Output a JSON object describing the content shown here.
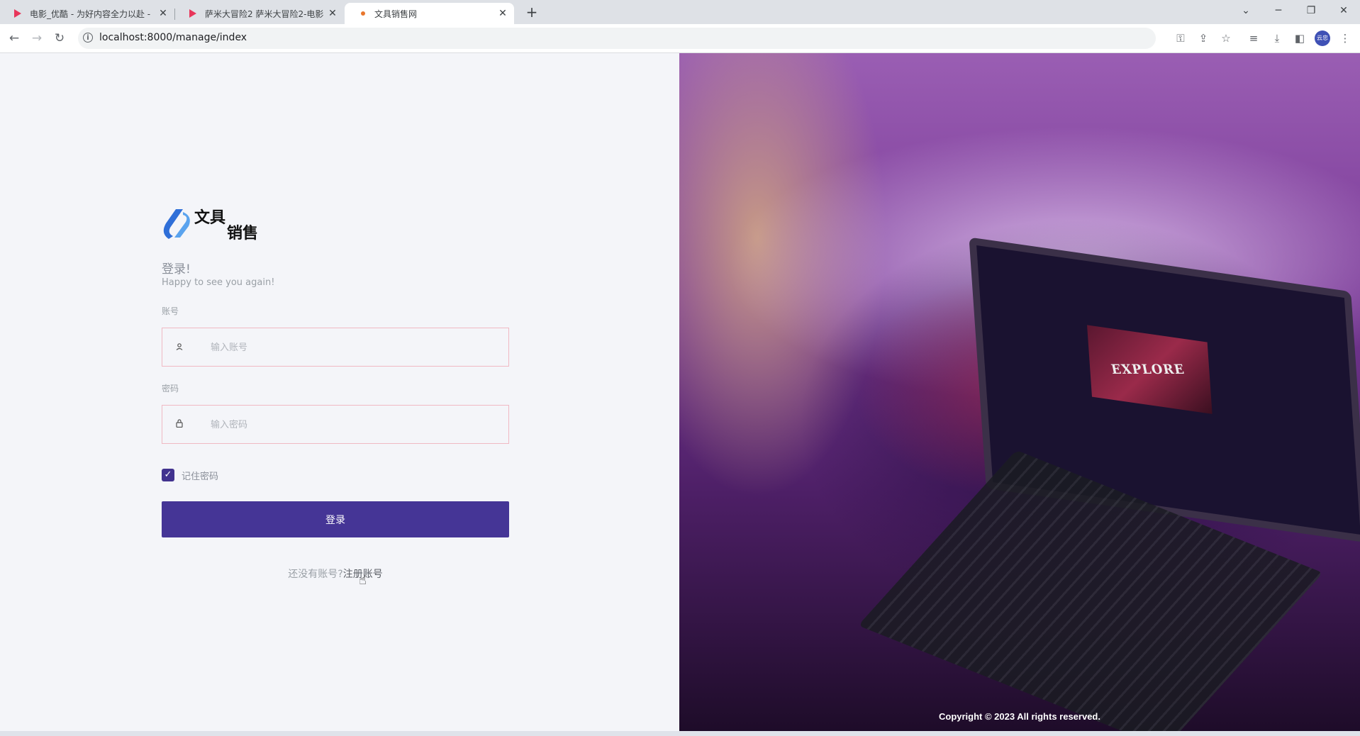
{
  "browser": {
    "tabs": [
      {
        "title": "电影_优酷 - 为好内容全力以赴 -"
      },
      {
        "title": "萨米大冒险2 萨米大冒险2-电影"
      },
      {
        "title": "文具销售网"
      }
    ],
    "url": "localhost:8000/manage/index",
    "profile_label": "云忠"
  },
  "brand": {
    "logo_line1": "文具",
    "logo_line2": "销售",
    "logo_colors": [
      "#2f6fd8",
      "#5aa3ee"
    ]
  },
  "login": {
    "title": "登录!",
    "subtitle": "Happy to see you again!",
    "account_label": "账号",
    "account_placeholder": "输入账号",
    "password_label": "密码",
    "password_placeholder": "输入密码",
    "remember_label": "记住密码",
    "remember_checked": true,
    "submit_label": "登录",
    "no_account_text": "还没有账号?",
    "register_link": "注册账号"
  },
  "hero": {
    "screen_text": "EXPLORE",
    "copyright": "Copyright © 2023 All rights reserved."
  },
  "colors": {
    "primary": "#453596",
    "field_border": "#f0b9c3",
    "left_bg": "#f4f5f9"
  }
}
